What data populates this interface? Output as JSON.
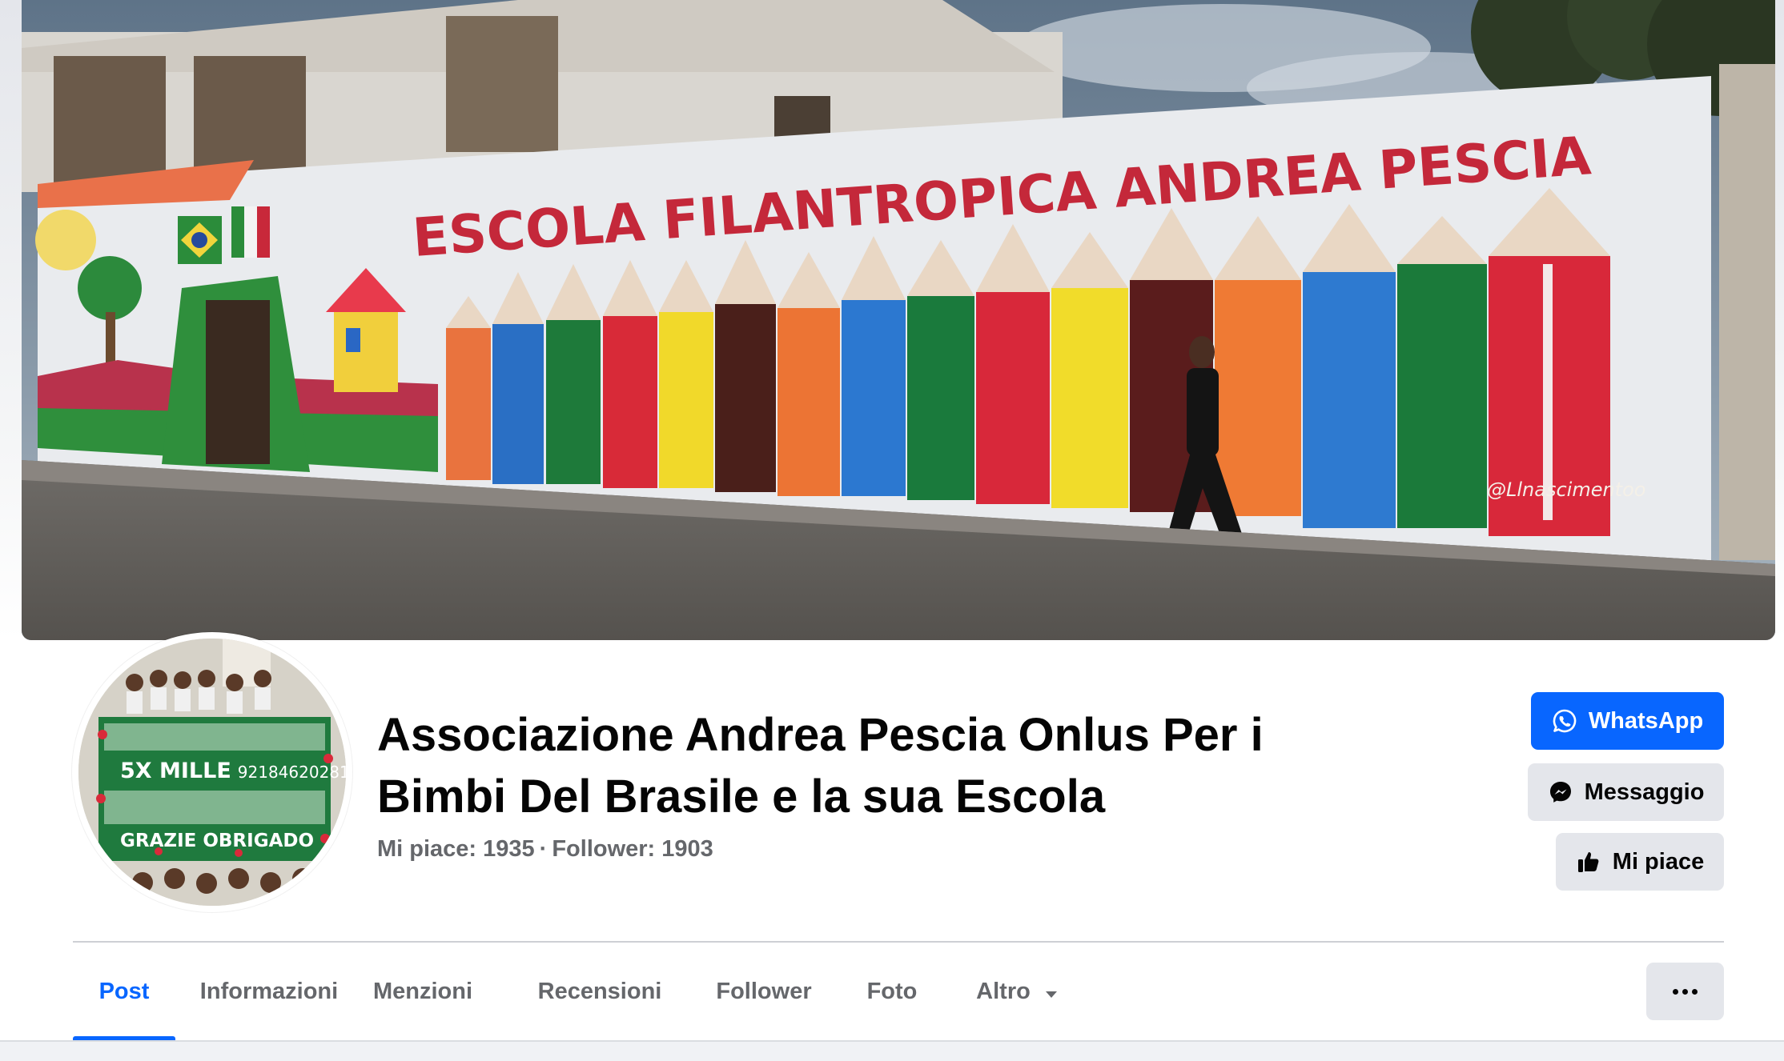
{
  "cover": {
    "mural_text": "ESCOLA FILANTROPICA ANDREA PESCIA",
    "signature": "@Llnascimentoo"
  },
  "avatar": {
    "banner_line1": "5X MILLE",
    "banner_code": "92184620281",
    "banner_line2": "GRAZIE OBRIGADO"
  },
  "page": {
    "title_line1": "Associazione Andrea Pescia Onlus Per i",
    "title_line2": "Bimbi Del Brasile e la sua Escola",
    "likes_label": "Mi piace: 1935",
    "separator": "·",
    "followers_label": "Follower: 1903"
  },
  "actions": {
    "whatsapp_label": "WhatsApp",
    "message_label": "Messaggio",
    "like_label": "Mi piace"
  },
  "tabs": [
    {
      "label": "Post",
      "active": true
    },
    {
      "label": "Informazioni",
      "active": false
    },
    {
      "label": "Menzioni",
      "active": false
    },
    {
      "label": "Recensioni",
      "active": false
    },
    {
      "label": "Follower",
      "active": false
    },
    {
      "label": "Foto",
      "active": false
    },
    {
      "label": "Altro",
      "active": false
    }
  ],
  "colors": {
    "brand_blue": "#0866ff",
    "secondary_button": "#e4e6eb",
    "muted_text": "#65676b",
    "primary_text": "#050505"
  },
  "icons": [
    "whatsapp-icon",
    "messenger-icon",
    "thumbs-up-icon",
    "caret-down-icon",
    "more-dots-icon"
  ]
}
